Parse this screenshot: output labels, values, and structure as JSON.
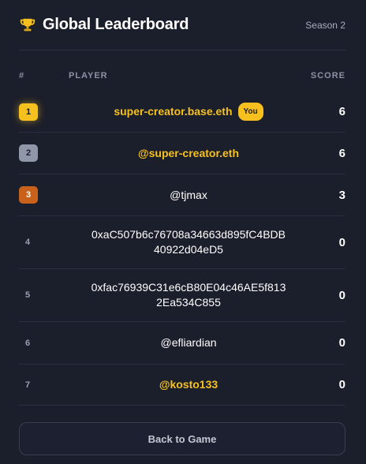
{
  "header": {
    "title": "Global Leaderboard",
    "season": "Season 2",
    "icon": "trophy-icon"
  },
  "columns": {
    "rank": "#",
    "player": "PLAYER",
    "score": "SCORE"
  },
  "players": [
    {
      "rank": "1",
      "name": "super-creator.base.eth",
      "score": "6",
      "you": "You"
    },
    {
      "rank": "2",
      "name": "@super-creator.eth",
      "score": "6"
    },
    {
      "rank": "3",
      "name": "@tjmax",
      "score": "3"
    },
    {
      "rank": "4",
      "name": "0xaC507b6c76708a34663d895fC4BDB40922d04eD5",
      "score": "0"
    },
    {
      "rank": "5",
      "name": "0xfac76939C31e6cB80E04c46AE5f8132Ea534C855",
      "score": "0"
    },
    {
      "rank": "6",
      "name": "@efliardian",
      "score": "0"
    },
    {
      "rank": "7",
      "name": "@kosto133",
      "score": "0"
    }
  ],
  "footer": {
    "back_label": "Back to Game"
  },
  "colors": {
    "background": "#1b1e2b",
    "accent_gold": "#f6c11e",
    "silver": "#8f97a8",
    "bronze": "#c8621a"
  }
}
